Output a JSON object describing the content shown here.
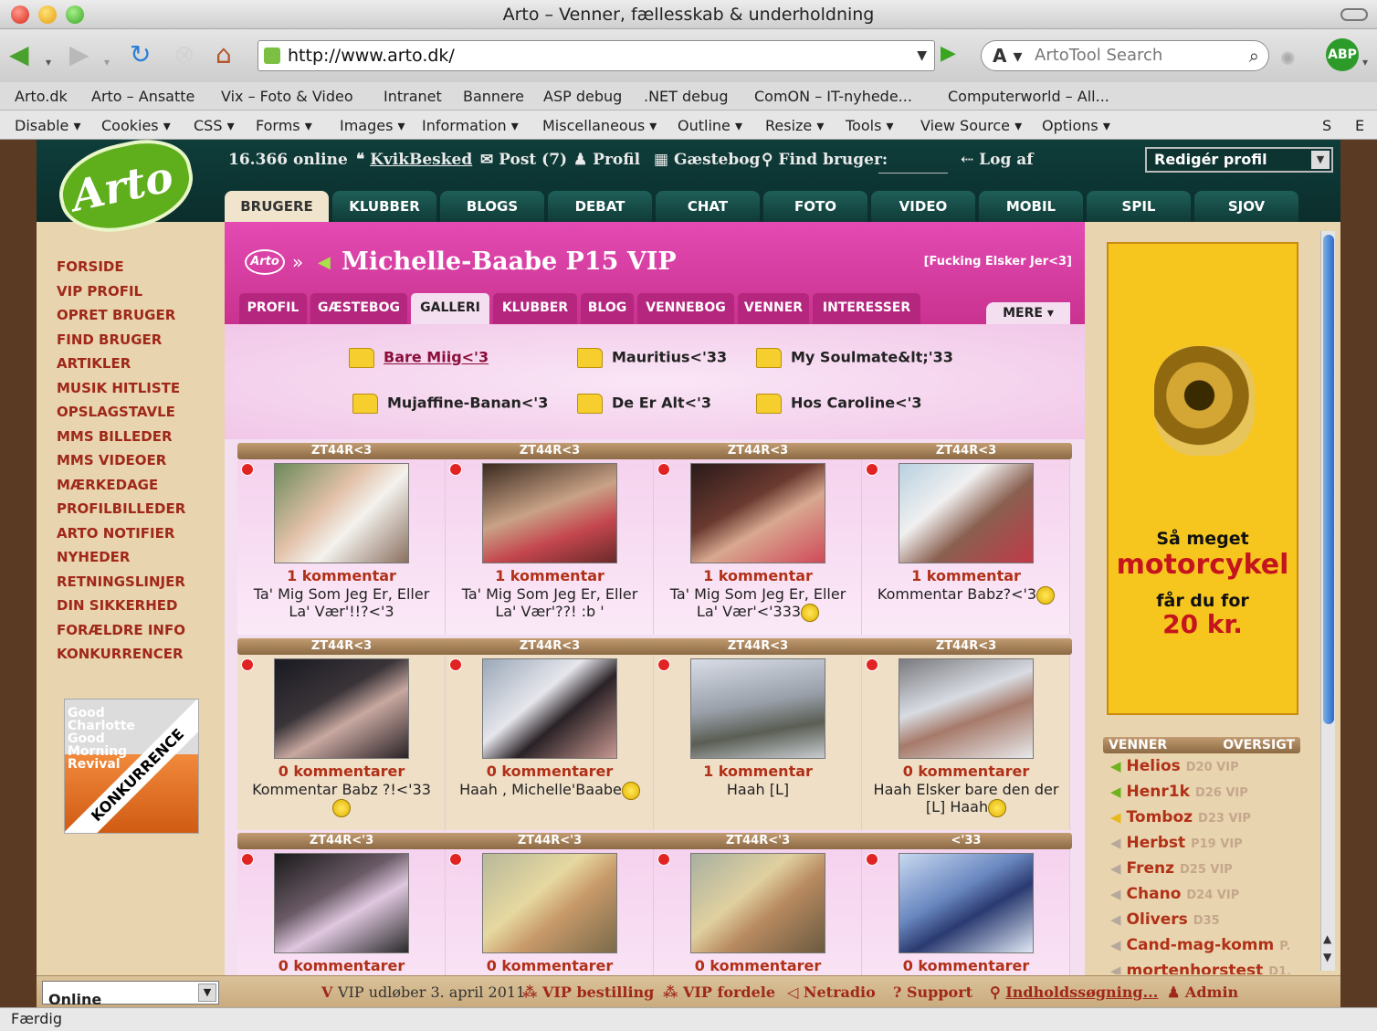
{
  "window": {
    "title": "Arto – Venner, fællesskab & underholdning"
  },
  "browser": {
    "url": "http://www.arto.dk/",
    "search_placeholder": "ArtoTool Search",
    "abp_label": "ABP",
    "bookmarks": [
      "Arto.dk",
      "Arto – Ansatte",
      "Vix – Foto & Video",
      "Intranet",
      "Bannere",
      "ASP debug",
      ".NET debug",
      "ComON – IT-nyhede...",
      "Computerworld – All..."
    ],
    "devtools": [
      "Disable ▾",
      "Cookies ▾",
      "CSS ▾",
      "Forms ▾",
      "Images ▾",
      "Information ▾",
      "Miscellaneous ▾",
      "Outline ▾",
      "Resize ▾",
      "Tools ▾",
      "View Source ▾",
      "Options ▾",
      "S",
      "E"
    ],
    "status": "Færdig"
  },
  "site": {
    "logo_text": "Arto",
    "online_count": "16.366 online",
    "kvikbesked": "KvikBesked",
    "post": "Post (7)",
    "profil": "Profil",
    "gaestebog": "Gæstebog",
    "find_bruger": "Find bruger:",
    "log_af": "Log af",
    "redig_profil": "Redigér profil",
    "tabs": [
      "BRUGERE",
      "KLUBBER",
      "BLOGS",
      "DEBAT",
      "CHAT",
      "FOTO",
      "VIDEO",
      "MOBIL",
      "SPIL",
      "SJOV"
    ],
    "sidenav": [
      "FORSIDE",
      "VIP PROFIL",
      "OPRET BRUGER",
      "FIND BRUGER",
      "ARTIKLER",
      "MUSIK HITLISTE",
      "OPSLAGSTAVLE",
      "MMS BILLEDER",
      "MMS VIDEOER",
      "MÆRKEDAGE",
      "PROFILBILLEDER",
      "ARTO NOTIFIER",
      "NYHEDER",
      "RETNINGSLINJER",
      "DIN SIKKERHED",
      "FORÆLDRE INFO",
      "KONKURRENCER"
    ],
    "konk_ad": {
      "text": "Good Charlotte Good Morning Revival",
      "band": "KONKURRENCE"
    }
  },
  "profile": {
    "logo_text": "Arto",
    "arrow": "»",
    "name": "Michelle-Baabe P15 VIP",
    "quote": "[Fucking Elsker Jer<3]",
    "subtabs": [
      "PROFIL",
      "GÆSTEBOG",
      "GALLERI",
      "KLUBBER",
      "BLOG",
      "VENNEBOG",
      "VENNER",
      "INTERESSER"
    ],
    "mere": "MERE ▾",
    "folders": [
      "Bare Miig<'3",
      "Mauritius<'33",
      "My Soulmate&lt;'33",
      "Mujaffine-Banan<'3",
      "De Er Alt<'3",
      "Hos Caroline<'3"
    ],
    "rows": [
      {
        "headers": [
          "ZT44R<3",
          "ZT44R<3",
          "ZT44R<3",
          "ZT44R<3"
        ],
        "cells": [
          {
            "kom": "1 kommentar",
            "cap": "Ta' Mig Som Jeg Er, Eller La' Vær'!!?<'3",
            "smiley": false
          },
          {
            "kom": "1 kommentar",
            "cap": "Ta' Mig Som Jeg Er, Eller La' Vær'??! :b '",
            "smiley": false
          },
          {
            "kom": "1 kommentar",
            "cap": "Ta' Mig Som Jeg Er, Eller La' Vær'<'333",
            "smiley": true
          },
          {
            "kom": "1 kommentar",
            "cap": "Kommentar Babz?<'3",
            "smiley": true
          }
        ]
      },
      {
        "headers": [
          "ZT44R<3",
          "ZT44R<3",
          "ZT44R<3",
          "ZT44R<3"
        ],
        "cells": [
          {
            "kom": "0 kommentarer",
            "cap": "Kommentar Babz ?!<'33",
            "smiley": true
          },
          {
            "kom": "0 kommentarer",
            "cap": "Haah , Michelle'Baabe",
            "smiley": true
          },
          {
            "kom": "1 kommentar",
            "cap": "Haah [L]",
            "smiley": false
          },
          {
            "kom": "0 kommentarer",
            "cap": "Haah Elsker bare den der [L] Haah",
            "smiley": true
          }
        ]
      },
      {
        "headers": [
          "ZT44R<'3",
          "ZT44R<'3",
          "ZT44R<'3",
          "<'33"
        ],
        "cells": [
          {
            "kom": "0 kommentarer",
            "cap": "",
            "smiley": false
          },
          {
            "kom": "0 kommentarer",
            "cap": "",
            "smiley": false
          },
          {
            "kom": "0 kommentarer",
            "cap": "",
            "smiley": false
          },
          {
            "kom": "0 kommentarer",
            "cap": "",
            "smiley": false
          }
        ]
      }
    ]
  },
  "ad": {
    "line1": "Så meget",
    "line2": "motorcykel",
    "line3": "får du for",
    "line4": "20 kr."
  },
  "friends": {
    "header_left": "VENNER",
    "header_right": "OVERSIGT",
    "items": [
      {
        "name": "Helios",
        "meta": "D20 VIP",
        "online": true
      },
      {
        "name": "Henr1k",
        "meta": "D26 VIP",
        "online": true
      },
      {
        "name": "Tomboz",
        "meta": "D23 VIP",
        "online": true
      },
      {
        "name": "Herbst",
        "meta": "P19 VIP",
        "online": false
      },
      {
        "name": "Frenz",
        "meta": "D25 VIP",
        "online": false
      },
      {
        "name": "Chano",
        "meta": "D24 VIP",
        "online": false
      },
      {
        "name": "Olivers",
        "meta": "D35",
        "online": false
      },
      {
        "name": "Cand-mag-komm",
        "meta": "P.",
        "online": false
      },
      {
        "name": "mortenhorstest",
        "meta": "D1.",
        "online": false
      }
    ]
  },
  "bottom": {
    "status_select": "Online",
    "vip_expires": "VIP udløber 3. april 2011",
    "vip_order": "VIP bestilling",
    "vip_benefits": "VIP fordele",
    "netradio": "Netradio",
    "support": "Support",
    "search": "Indholdssøgning...",
    "admin": "Admin"
  },
  "colors": {
    "pink": "#e44ab3",
    "teal": "#0e3d3a",
    "accent_red": "#b03018",
    "ad_yellow": "#f7c61e"
  }
}
